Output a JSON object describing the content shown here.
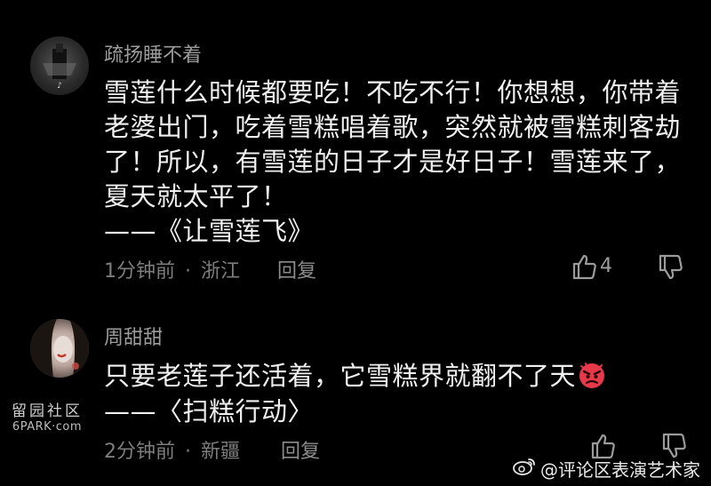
{
  "comments": [
    {
      "username": "疏扬睡不着",
      "lines": [
        "雪莲什么时候都要吃！不吃不行！你想想，你带着",
        "老婆出门，吃着雪糕唱着歌，突然就被雪糕刺客劫",
        "了！所以，有雪莲的日子才是好日子！雪莲来了，",
        "夏天就太平了！",
        "——《让雪莲飞》"
      ],
      "time": "1分钟前",
      "separator": "·",
      "location": "浙江",
      "reply_label": "回复",
      "like_count": "4"
    },
    {
      "username": "周甜甜",
      "lines": [
        "只要老莲子还活着，它雪糕界就翻不了天",
        "——〈扫糕行动〉"
      ],
      "time": "2分钟前",
      "separator": "·",
      "location": "新疆",
      "reply_label": "回复",
      "like_count": ""
    }
  ],
  "watermarks": {
    "forum_cn": "留园社区",
    "forum_en": "6PARK·com",
    "weibo_handle": "@评论区表演艺术家"
  },
  "colors": {
    "background": "#000000",
    "text": "#f0f0f0",
    "muted": "#7d7d7d",
    "emoji": "#e8394a"
  }
}
